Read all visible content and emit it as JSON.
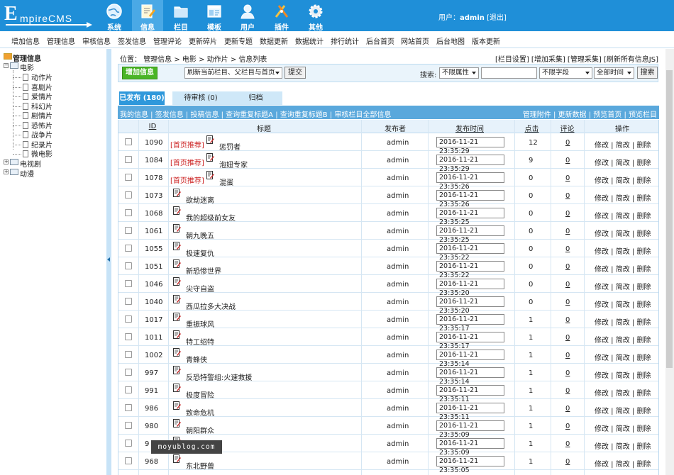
{
  "logo": {
    "big": "E",
    "rest": "mpireCMS"
  },
  "main_tabs": [
    {
      "label": "系统",
      "icon": "globe-icon"
    },
    {
      "label": "信息",
      "icon": "document-edit-icon"
    },
    {
      "label": "栏目",
      "icon": "folder-icon"
    },
    {
      "label": "模板",
      "icon": "template-icon"
    },
    {
      "label": "用户",
      "icon": "user-icon"
    },
    {
      "label": "插件",
      "icon": "tools-icon"
    },
    {
      "label": "其他",
      "icon": "gear-icon"
    }
  ],
  "user": {
    "prefix": "用户：",
    "name": "admin",
    "logout": "[退出]"
  },
  "submenu": [
    "增加信息",
    "管理信息",
    "审核信息",
    "签发信息",
    "管理评论",
    "更新碎片",
    "更新专题",
    "数据更新",
    "数据统计",
    "排行统计",
    "后台首页",
    "网站首页",
    "后台地图",
    "版本更新"
  ],
  "tree": {
    "root": "管理信息",
    "movie": "电影",
    "children": [
      "动作片",
      "喜剧片",
      "爱情片",
      "科幻片",
      "剧情片",
      "恐怖片",
      "战争片",
      "纪录片",
      "微电影"
    ],
    "tv": "电视剧",
    "anime": "动漫"
  },
  "breadcrumb": "位置：  管理信息 > 电影 > 动作片 > 信息列表",
  "top_links": "[栏目设置] [增加采集] [管理采集] [刷新所有信息JS]",
  "toolbar": {
    "add_button": "增加信息",
    "refresh_select": "刷新当前栏目、父栏目与首页",
    "submit": "提交",
    "search_label": "搜索:",
    "attr_select": "不限属性",
    "field_select": "不限字段",
    "time_select": "全部时间",
    "search_button": "搜索"
  },
  "status_tabs": [
    {
      "label": "已发布 (180)",
      "active": true
    },
    {
      "label": "待审核 (0)",
      "active": false
    },
    {
      "label": "归档",
      "active": false
    }
  ],
  "list_bar": {
    "left": "我的信息 | 签发信息 | 投稿信息 | 查询重复标题A | 查询重复标题B | 审核栏目全部信息",
    "right": "管理附件 | 更新数据 | 预览首页 | 预览栏目"
  },
  "table": {
    "headers": {
      "id": "ID",
      "title": "标题",
      "publisher": "发布者",
      "time": "发布时间",
      "clicks": "点击",
      "comments": "评论",
      "actions": "操作"
    },
    "action_text": "修改 | 简改 | 删除",
    "rows": [
      {
        "id": "1090",
        "rec": "[首页推荐]",
        "title": "惩罚者",
        "pub": "admin",
        "time": "2016-11-21 23:35:29",
        "clicks": "12",
        "comments": "0"
      },
      {
        "id": "1084",
        "rec": "[首页推荐]",
        "title": "泡妞专家",
        "pub": "admin",
        "time": "2016-11-21 23:35:29",
        "clicks": "9",
        "comments": "0"
      },
      {
        "id": "1078",
        "rec": "[首页推荐]",
        "title": "混蛋",
        "pub": "admin",
        "time": "2016-11-21 23:35:26",
        "clicks": "0",
        "comments": "0"
      },
      {
        "id": "1073",
        "rec": "",
        "title": "欲劫迷离",
        "pub": "admin",
        "time": "2016-11-21 23:35:26",
        "clicks": "0",
        "comments": "0"
      },
      {
        "id": "1068",
        "rec": "",
        "title": "我的超级前女友",
        "pub": "admin",
        "time": "2016-11-21 23:35:25",
        "clicks": "0",
        "comments": "0"
      },
      {
        "id": "1061",
        "rec": "",
        "title": "朝九晚五",
        "pub": "admin",
        "time": "2016-11-21 23:35:25",
        "clicks": "0",
        "comments": "0"
      },
      {
        "id": "1055",
        "rec": "",
        "title": "极速复仇",
        "pub": "admin",
        "time": "2016-11-21 23:35:22",
        "clicks": "0",
        "comments": "0"
      },
      {
        "id": "1051",
        "rec": "",
        "title": "新恐惨世界",
        "pub": "admin",
        "time": "2016-11-21 23:35:22",
        "clicks": "0",
        "comments": "0"
      },
      {
        "id": "1046",
        "rec": "",
        "title": "尖守自盗",
        "pub": "admin",
        "time": "2016-11-21 23:35:20",
        "clicks": "0",
        "comments": "0"
      },
      {
        "id": "1040",
        "rec": "",
        "title": "西瓜拉多大决战",
        "pub": "admin",
        "time": "2016-11-21 23:35:20",
        "clicks": "0",
        "comments": "0"
      },
      {
        "id": "1017",
        "rec": "",
        "title": "重振球风",
        "pub": "admin",
        "time": "2016-11-21 23:35:17",
        "clicks": "1",
        "comments": "0"
      },
      {
        "id": "1011",
        "rec": "",
        "title": "特工绍特",
        "pub": "admin",
        "time": "2016-11-21 23:35:17",
        "clicks": "1",
        "comments": "0"
      },
      {
        "id": "1002",
        "rec": "",
        "title": "青蜂侠",
        "pub": "admin",
        "time": "2016-11-21 23:35:14",
        "clicks": "1",
        "comments": "0"
      },
      {
        "id": "997",
        "rec": "",
        "title": "反恐特警组:火速救援",
        "pub": "admin",
        "time": "2016-11-21 23:35:14",
        "clicks": "1",
        "comments": "0"
      },
      {
        "id": "991",
        "rec": "",
        "title": "极度冒险",
        "pub": "admin",
        "time": "2016-11-21 23:35:11",
        "clicks": "1",
        "comments": "0"
      },
      {
        "id": "986",
        "rec": "",
        "title": "致命危机",
        "pub": "admin",
        "time": "2016-11-21 23:35:11",
        "clicks": "1",
        "comments": "0"
      },
      {
        "id": "980",
        "rec": "",
        "title": "朝阳群众",
        "pub": "admin",
        "time": "2016-11-21 23:35:09",
        "clicks": "1",
        "comments": "0"
      },
      {
        "id": "9",
        "rec": "",
        "title": "",
        "pub": "admin",
        "time": "2016-11-21 23:35:09",
        "clicks": "1",
        "comments": "0"
      },
      {
        "id": "968",
        "rec": "",
        "title": "东北野兽",
        "pub": "admin",
        "time": "2016-11-21 23:35:05",
        "clicks": "1",
        "comments": "0"
      }
    ]
  },
  "watermark": "moyublog.com",
  "colors": {
    "header": "#1f8fd8",
    "active_tab": "#4aa9e6",
    "list_bar": "#5aa8dc",
    "recommend": "#cc2222",
    "add_button": "#4ab526"
  }
}
